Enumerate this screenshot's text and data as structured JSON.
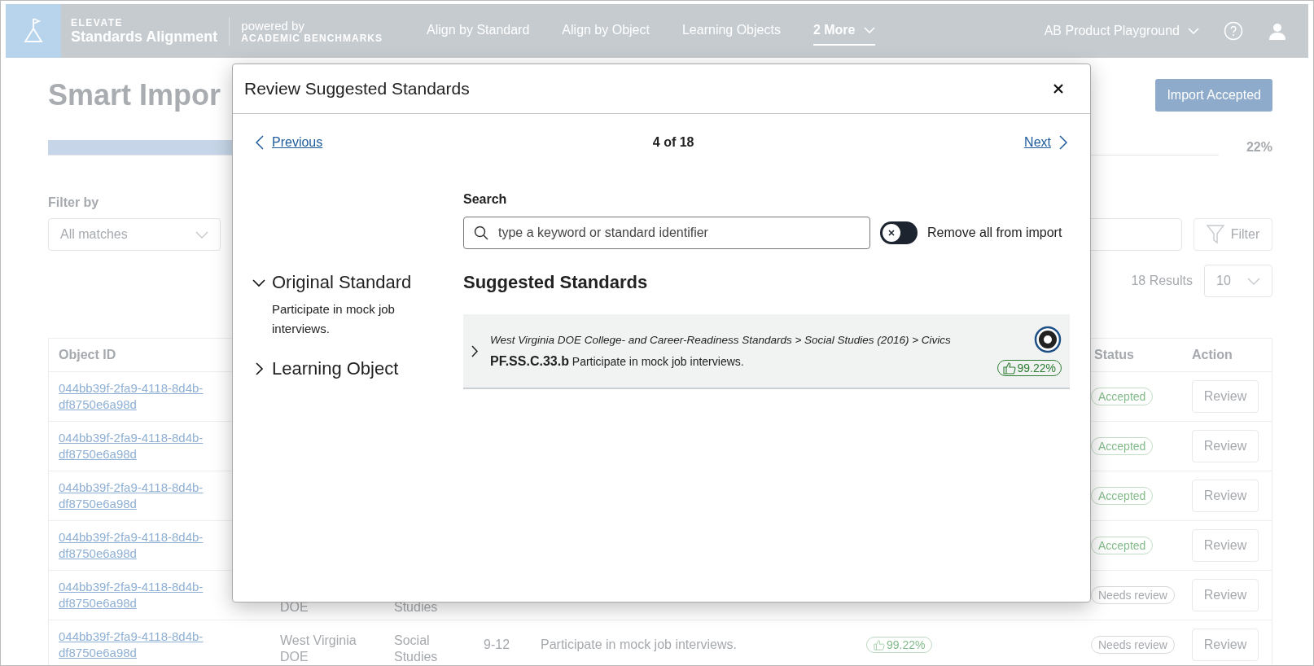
{
  "header": {
    "brand_top": "ELEVATE",
    "brand_name": "Standards Alignment",
    "powered_by": "powered by",
    "powered_brand": "ACADEMIC BENCHMARKS",
    "nav": [
      {
        "label": "Align by Standard",
        "selected": false,
        "menu": false
      },
      {
        "label": "Align by Object",
        "selected": false,
        "menu": false
      },
      {
        "label": "Learning Objects",
        "selected": false,
        "menu": false
      },
      {
        "label": "2 More",
        "selected": true,
        "menu": true
      }
    ],
    "workspace": "AB Product Playground"
  },
  "page": {
    "title": "Smart Impor",
    "import_button": "Import Accepted",
    "progress": {
      "level": 0.22,
      "reading": "22%"
    },
    "filter_label": "Filter by",
    "filter_select": "All matches",
    "filter_button": "Filter",
    "results": "18 Results",
    "page_size": "10"
  },
  "table": {
    "columns": {
      "object_id": "Object ID",
      "status": "Status",
      "action": "Action"
    },
    "rows": [
      {
        "object_id": "044bb39f-2fa9-4118-8d4b-df8750e6a98d",
        "status": {
          "label": "Accepted",
          "kind": "accepted"
        },
        "action": "Review"
      },
      {
        "object_id": "044bb39f-2fa9-4118-8d4b-df8750e6a98d",
        "status": {
          "label": "Accepted",
          "kind": "accepted"
        },
        "action": "Review"
      },
      {
        "object_id": "044bb39f-2fa9-4118-8d4b-df8750e6a98d",
        "status": {
          "label": "Accepted",
          "kind": "accepted"
        },
        "action": "Review"
      },
      {
        "object_id": "044bb39f-2fa9-4118-8d4b-df8750e6a98d",
        "status": {
          "label": "Accepted",
          "kind": "accepted"
        },
        "action": "Review"
      },
      {
        "object_id": "044bb39f-2fa9-4118-8d4b-df8750e6a98d",
        "column_2": "DOE",
        "column_3": "Studies",
        "status": {
          "label": "Needs review",
          "kind": "needs_review"
        },
        "action": "Review"
      },
      {
        "object_id": "044bb39f-2fa9-4118-8d4b-df8750e6a98d",
        "column_2": "West Virginia DOE",
        "column_3": "Social Studies",
        "column_4": "9-12",
        "column_5": "Participate in mock job interviews.",
        "match": "99.22%",
        "status": {
          "label": "Needs review",
          "kind": "needs_review"
        },
        "action": "Review"
      }
    ]
  },
  "modal": {
    "title": "Review Suggested Standards",
    "previous": "Previous",
    "position": "4 of 18",
    "next": "Next",
    "sections": [
      {
        "label": "Original Standard",
        "expanded": true,
        "text": "Participate in mock job interviews."
      },
      {
        "label": "Learning Object",
        "expanded": false
      }
    ],
    "search": {
      "label": "Search",
      "placeholder": "type a keyword or standard identifier"
    },
    "remove_all": {
      "label": "Remove all from import",
      "on": false
    },
    "suggested_heading": "Suggested Standards",
    "suggestions": [
      {
        "path": "West Virginia DOE College- and Career-Readiness Standards > Social Studies (2016) > Civics",
        "code": "PF.SS.C.33.b",
        "description": "Participate in mock job interviews.",
        "match": "99.22%",
        "selected": true,
        "expanded": false
      }
    ]
  }
}
